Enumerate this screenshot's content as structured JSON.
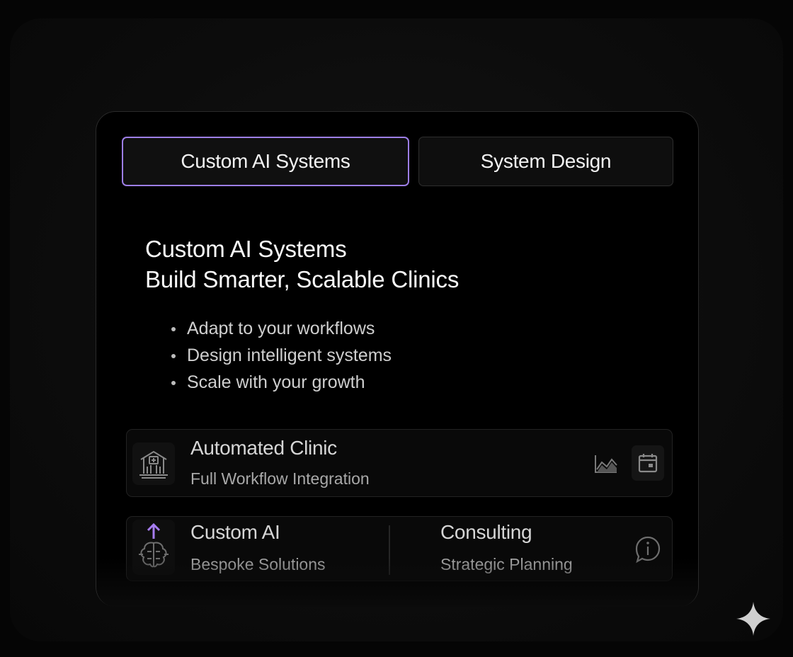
{
  "tabs": [
    {
      "label": "Custom AI Systems",
      "active": true
    },
    {
      "label": "System Design",
      "active": false
    }
  ],
  "headline": {
    "line1": "Custom AI Systems",
    "line2": "Build Smarter, Scalable Clinics"
  },
  "bullets": [
    "Adapt to your workflows",
    "Design intelligent systems",
    "Scale with your growth"
  ],
  "features": {
    "automated": {
      "title": "Automated Clinic",
      "subtitle": "Full Workflow Integration",
      "icon": "clinic-building-icon",
      "actions": [
        "chart-icon",
        "calendar-icon"
      ]
    },
    "custom_ai": {
      "title": "Custom AI",
      "subtitle": "Bespoke Solutions",
      "icon": "brain-upgrade-icon"
    },
    "consulting": {
      "title": "Consulting",
      "subtitle": "Strategic Planning",
      "icon": "info-chat-icon"
    }
  },
  "colors": {
    "accent": "#9d7ee6",
    "background": "#000000"
  }
}
